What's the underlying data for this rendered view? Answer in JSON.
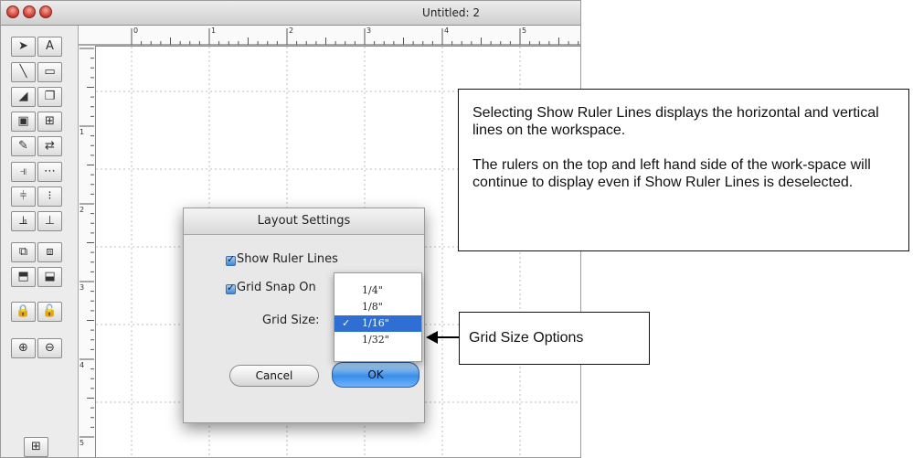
{
  "window": {
    "title": "Untitled: 2"
  },
  "toolbox": {
    "tools": [
      {
        "name": "select-arrow-icon"
      },
      {
        "name": "text-tool-icon"
      },
      {
        "name": "line-tool-icon"
      },
      {
        "name": "rectangle-tool-icon"
      },
      {
        "name": "stamp-tool-icon"
      },
      {
        "name": "copy-tool-icon"
      },
      {
        "name": "image-tool-icon"
      },
      {
        "name": "table-tool-icon"
      },
      {
        "name": "color-tool-icon"
      },
      {
        "name": "link-tool-icon"
      },
      {
        "name": "align-left-icon"
      },
      {
        "name": "align-center-h-icon"
      },
      {
        "name": "align-middle-icon"
      },
      {
        "name": "align-center-v-icon"
      },
      {
        "name": "align-bottom-icon"
      },
      {
        "name": "align-bottom-row-icon"
      },
      {
        "name": "bring-forward-icon"
      },
      {
        "name": "send-backward-icon"
      },
      {
        "name": "bring-front-icon"
      },
      {
        "name": "send-back-icon"
      },
      {
        "name": "lock-icon"
      },
      {
        "name": "unlock-icon"
      },
      {
        "name": "zoom-in-icon"
      },
      {
        "name": "zoom-out-icon"
      },
      {
        "name": "grid-icon"
      }
    ]
  },
  "ruler": {
    "top_numbers": [
      "0",
      "1",
      "2",
      "3",
      "4",
      "5"
    ],
    "left_numbers": [
      "1",
      "2",
      "3",
      "4",
      "5"
    ]
  },
  "dialog": {
    "title": "Layout Settings",
    "show_ruler_lines": {
      "label": "Show Ruler Lines",
      "checked": true
    },
    "grid_snap_on": {
      "label": "Grid Snap On",
      "checked": true
    },
    "grid_size_label": "Grid Size:",
    "grid_options": [
      "1/4\"",
      "1/8\"",
      "1/16\"",
      "1/32\""
    ],
    "grid_selected": "1/16\"",
    "selected_check": "✓",
    "cancel_label": "Cancel",
    "ok_label": "OK"
  },
  "annotation": {
    "para1": "Selecting Show Ruler Lines displays the horizontal and vertical lines on the workspace.",
    "para2": "The rulers on the top and left hand side of the work-space will continue to display even if Show Ruler Lines is deselected."
  },
  "callout": {
    "label": "Grid Size Options"
  },
  "colors": {
    "selection": "#2f6fd4",
    "ok_button": "#3a8ee8"
  }
}
